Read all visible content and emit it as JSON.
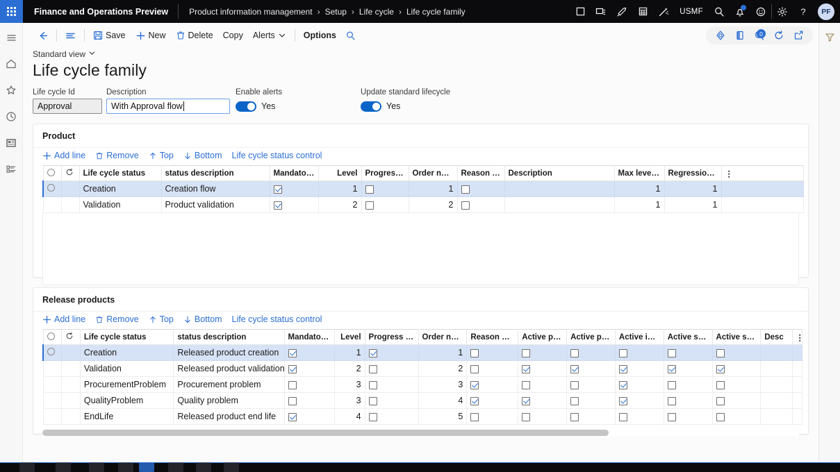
{
  "topbar": {
    "waffle_icon": "app-launcher-icon",
    "app_title": "Finance and Operations Preview",
    "breadcrumbs": [
      "Product information management",
      "Setup",
      "Life cycle",
      "Life cycle family"
    ],
    "separator": "›",
    "company": "USMF",
    "icons": [
      "window-icon",
      "duplicate-window-icon",
      "rocket-icon",
      "calculator-icon",
      "magic-wand-icon",
      "search-icon",
      "notifications-icon",
      "feedback-smiley-icon",
      "settings-gear-icon",
      "help-question-icon"
    ],
    "avatar_initials": "PF"
  },
  "left_rail": {
    "items": [
      {
        "name": "hamburger-menu-icon"
      },
      {
        "name": "home-icon"
      },
      {
        "name": "favorites-star-icon"
      },
      {
        "name": "recent-clock-icon"
      },
      {
        "name": "workspaces-icon"
      },
      {
        "name": "modules-list-icon"
      }
    ]
  },
  "right_rail": {
    "filter_icon": "filter-funnel-icon"
  },
  "command_bar": {
    "back_icon": "back-arrow-icon",
    "nav_icon": "navigation-lines-icon",
    "save_label": "Save",
    "save_icon": "save-disk-icon",
    "new_label": "New",
    "new_icon": "plus-icon",
    "delete_label": "Delete",
    "delete_icon": "trash-icon",
    "copy_label": "Copy",
    "alerts_label": "Alerts",
    "alerts_chevron": "chevron-down-icon",
    "options_label": "Options",
    "search_icon": "search-icon",
    "right_icons": [
      "share-icon",
      "office-app-icon",
      "attachments-icon",
      "refresh-icon",
      "open-in-new-icon"
    ],
    "attachments_count": "0"
  },
  "header": {
    "view_label": "Standard view",
    "view_chevron": "chevron-down-icon",
    "title": "Life cycle family"
  },
  "fields": {
    "lifecycle_id": {
      "label": "Life cycle Id",
      "value": "Approval"
    },
    "description": {
      "label": "Description",
      "value": "With Approval flow"
    },
    "enable_alerts": {
      "label": "Enable alerts",
      "value": "Yes"
    },
    "update_standard_lifecycle": {
      "label": "Update standard lifecycle",
      "value": "Yes"
    }
  },
  "product_section": {
    "title": "Product",
    "toolbar": {
      "add_line": "Add line",
      "remove": "Remove",
      "top": "Top",
      "bottom": "Bottom",
      "status_control": "Life cycle status control"
    },
    "columns": [
      "Life cycle status",
      "status description",
      "Mandatory...",
      "Level",
      "Progress a...",
      "Order num...",
      "Reason mu...",
      "Description",
      "Max level ...",
      "Regression..."
    ],
    "rows": [
      {
        "selected": true,
        "status": "Creation",
        "status_description": "Creation flow",
        "mandatory": true,
        "level": "1",
        "progress": false,
        "order_number": "1",
        "reason": false,
        "description": "",
        "max_level": "1",
        "regression": "1"
      },
      {
        "selected": false,
        "status": "Validation",
        "status_description": "Product validation",
        "mandatory": true,
        "level": "2",
        "progress": false,
        "order_number": "2",
        "reason": false,
        "description": "",
        "max_level": "1",
        "regression": "1"
      }
    ]
  },
  "release_section": {
    "title": "Release products",
    "toolbar": {
      "add_line": "Add line",
      "remove": "Remove",
      "top": "Top",
      "bottom": "Bottom",
      "status_control": "Life cycle status control"
    },
    "columns": [
      "Life cycle status",
      "status description",
      "Mandatory...",
      "Level",
      "Progress a...",
      "Order num...",
      "Reason mu...",
      "Active pur...",
      "Active pur...",
      "Active inve...",
      "Active sale",
      "Active sale...",
      "Desc"
    ],
    "rows": [
      {
        "selected": true,
        "status": "Creation",
        "status_description": "Released product creation",
        "mandatory": true,
        "level": "1",
        "progress": true,
        "order_number": "1",
        "reason": false,
        "active_pur1": false,
        "active_pur2": false,
        "active_inve": false,
        "active_sale": false,
        "active_sale2": false,
        "desc": ""
      },
      {
        "selected": false,
        "status": "Validation",
        "status_description": "Released product validation",
        "mandatory": true,
        "level": "2",
        "progress": false,
        "order_number": "2",
        "reason": false,
        "active_pur1": true,
        "active_pur2": true,
        "active_inve": true,
        "active_sale": true,
        "active_sale2": true,
        "desc": ""
      },
      {
        "selected": false,
        "status": "ProcurementProblem",
        "status_description": "Procurement problem",
        "mandatory": false,
        "level": "3",
        "progress": false,
        "order_number": "3",
        "reason": true,
        "active_pur1": false,
        "active_pur2": false,
        "active_inve": true,
        "active_sale": false,
        "active_sale2": false,
        "desc": ""
      },
      {
        "selected": false,
        "status": "QualityProblem",
        "status_description": "Quality problem",
        "mandatory": false,
        "level": "3",
        "progress": false,
        "order_number": "4",
        "reason": true,
        "active_pur1": true,
        "active_pur2": false,
        "active_inve": true,
        "active_sale": false,
        "active_sale2": false,
        "desc": ""
      },
      {
        "selected": false,
        "status": "EndLife",
        "status_description": "Released product end life",
        "mandatory": true,
        "level": "4",
        "progress": false,
        "order_number": "5",
        "reason": false,
        "active_pur1": false,
        "active_pur2": false,
        "active_inve": false,
        "active_sale": false,
        "active_sale2": false,
        "desc": ""
      }
    ]
  },
  "colors": {
    "accent": "#2b6fd4",
    "topbar_bg": "#0b0b0e",
    "selected_row": "#d6e2f5",
    "toggle_on": "#0a64c8"
  }
}
